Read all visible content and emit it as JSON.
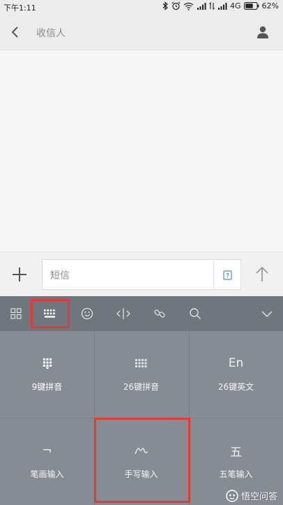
{
  "status_bar": {
    "time": "下午1:11",
    "network": "4G",
    "battery": "62%",
    "icons": [
      "bluetooth-icon",
      "alarm-icon",
      "wifi-icon",
      "signal-icon",
      "data-icon",
      "signal-icon",
      "battery-icon"
    ]
  },
  "header": {
    "title": "收信人",
    "back_icon": "chevron-left-icon",
    "contact_icon": "person-icon"
  },
  "compose": {
    "placeholder": "短信",
    "add_icon": "plus-icon",
    "sim_icon": "sim-card-icon",
    "send_icon": "arrow-up-icon"
  },
  "keyboard_toolbar": {
    "items": [
      "grid-icon",
      "keyboard-icon",
      "emoji-icon",
      "cursor-icon",
      "link-icon",
      "search-icon",
      "chevron-down-icon"
    ],
    "selected": "keyboard-icon"
  },
  "keyboard_layouts": [
    {
      "label": "9键拼音",
      "symbol_icon": "nine-key-icon",
      "selected": true
    },
    {
      "label": "26键拼音",
      "symbol_icon": "full-keyboard-icon",
      "selected": false
    },
    {
      "label": "26键英文",
      "symbol": "En",
      "selected": false
    },
    {
      "label": "笔画输入",
      "symbol": "¬",
      "selected": false
    },
    {
      "label": "手写输入",
      "symbol_icon": "handwriting-icon",
      "selected": false
    },
    {
      "label": "五笔输入",
      "symbol": "五",
      "selected": false
    }
  ],
  "watermark": {
    "text": "悟空问答"
  },
  "colors": {
    "accent_red": "#e53935",
    "keyboard_bg": "#868c93",
    "toolbar_bg": "#6f767e"
  }
}
